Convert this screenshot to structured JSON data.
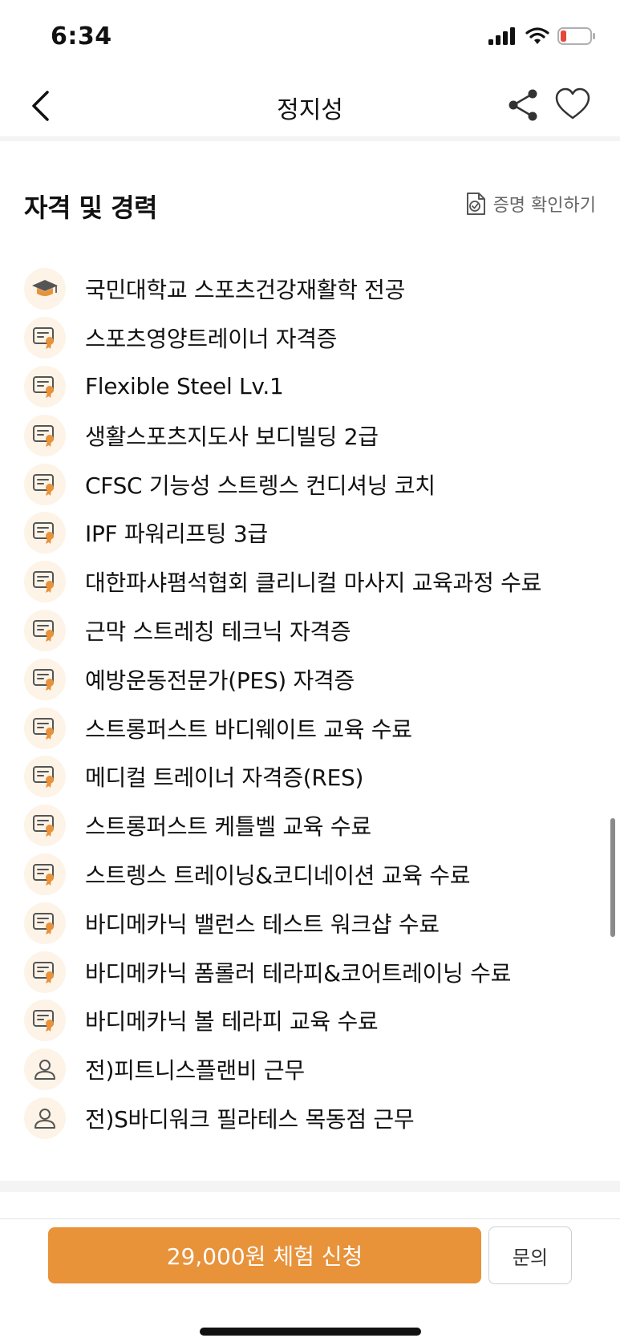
{
  "status": {
    "time": "6:34"
  },
  "header": {
    "title": "정지성"
  },
  "section": {
    "title": "자격 및 경력",
    "proof_link": "증명 확인하기"
  },
  "credentials": [
    {
      "type": "education",
      "icon": "graduation-cap-icon",
      "text": "국민대학교 스포츠건강재활학 전공"
    },
    {
      "type": "certificate",
      "icon": "certificate-icon",
      "text": "스포츠영양트레이너 자격증"
    },
    {
      "type": "certificate",
      "icon": "certificate-icon",
      "text": "Flexible Steel Lv.1"
    },
    {
      "type": "certificate",
      "icon": "certificate-icon",
      "text": "생활스포츠지도사 보디빌딩 2급"
    },
    {
      "type": "certificate",
      "icon": "certificate-icon",
      "text": "CFSC 기능성 스트렝스 컨디셔닝 코치"
    },
    {
      "type": "certificate",
      "icon": "certificate-icon",
      "text": "IPF 파워리프팅 3급"
    },
    {
      "type": "certificate",
      "icon": "certificate-icon",
      "text": "대한파샤폄석협회 클리니컬 마사지 교육과정 수료"
    },
    {
      "type": "certificate",
      "icon": "certificate-icon",
      "text": "근막 스트레칭 테크닉 자격증"
    },
    {
      "type": "certificate",
      "icon": "certificate-icon",
      "text": "예방운동전문가(PES) 자격증"
    },
    {
      "type": "certificate",
      "icon": "certificate-icon",
      "text": "스트롱퍼스트 바디웨이트 교육 수료"
    },
    {
      "type": "certificate",
      "icon": "certificate-icon",
      "text": "메디컬 트레이너 자격증(RES)"
    },
    {
      "type": "certificate",
      "icon": "certificate-icon",
      "text": "스트롱퍼스트 케틀벨 교육 수료"
    },
    {
      "type": "certificate",
      "icon": "certificate-icon",
      "text": "스트렝스 트레이닝&코디네이션 교육 수료"
    },
    {
      "type": "certificate",
      "icon": "certificate-icon",
      "text": "바디메카닉 밸런스 테스트 워크샵 수료"
    },
    {
      "type": "certificate",
      "icon": "certificate-icon",
      "text": "바디메카닉 폼롤러 테라피&코어트레이닝 수료"
    },
    {
      "type": "certificate",
      "icon": "certificate-icon",
      "text": "바디메카닉 볼 테라피 교육 수료"
    },
    {
      "type": "career",
      "icon": "person-icon",
      "text": "전)피트니스플랜비 근무"
    },
    {
      "type": "career",
      "icon": "person-icon",
      "text": "전)S바디워크 필라테스 목동점 근무"
    }
  ],
  "footer": {
    "apply_label": "29,000원 체험 신청",
    "inquiry_label": "문의"
  },
  "colors": {
    "accent": "#e8923a",
    "icon_bg": "#fdf3e7",
    "icon_stroke": "#555555"
  }
}
